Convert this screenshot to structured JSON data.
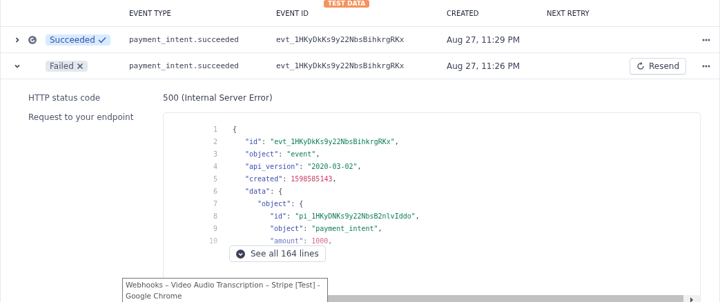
{
  "badge": "TEST DATA",
  "table": {
    "columns": [
      "EVENT TYPE",
      "EVENT ID",
      "CREATED",
      "NEXT RETRY"
    ],
    "rows": [
      {
        "expanded": false,
        "retried_icon": true,
        "status": "Succeeded",
        "kind": "succeeded",
        "event_type": "payment_intent.succeeded",
        "event_id": "evt_1HKyDkKs9y22NbsBihkrgRKx",
        "created": "Aug 27, 11:29 PM"
      },
      {
        "expanded": true,
        "retried_icon": false,
        "status": "Failed",
        "kind": "failed",
        "event_type": "payment_intent.succeeded",
        "event_id": "evt_1HKyDkKs9y22NbsBihkrgRKx",
        "created": "Aug 27, 11:26 PM",
        "action": "Resend"
      }
    ]
  },
  "details": {
    "fields": [
      {
        "label": "HTTP status code",
        "value": "500 (Internal Server Error)"
      }
    ],
    "request_label": "Request to your endpoint",
    "code": [
      {
        "number": "1",
        "tokens": [
          {
            "kind": "punct",
            "text": "{"
          }
        ]
      },
      {
        "number": "2",
        "tokens": [
          {
            "kind": "key",
            "text": "\"id\""
          },
          {
            "kind": "punct",
            "text": ": "
          },
          {
            "kind": "string",
            "text": "\"evt_1HKyDkKs9y22NbsBihkrgRKx\""
          },
          {
            "kind": "punct",
            "text": ","
          }
        ]
      },
      {
        "number": "3",
        "tokens": [
          {
            "kind": "key",
            "text": "\"object\""
          },
          {
            "kind": "punct",
            "text": ": "
          },
          {
            "kind": "string",
            "text": "\"event\""
          },
          {
            "kind": "punct",
            "text": ","
          }
        ]
      },
      {
        "number": "4",
        "tokens": [
          {
            "kind": "key",
            "text": "\"api_version\""
          },
          {
            "kind": "punct",
            "text": ": "
          },
          {
            "kind": "string",
            "text": "\"2020-03-02\""
          },
          {
            "kind": "punct",
            "text": ","
          }
        ]
      },
      {
        "number": "5",
        "tokens": [
          {
            "kind": "key",
            "text": "\"created\""
          },
          {
            "kind": "punct",
            "text": ": "
          },
          {
            "kind": "number",
            "text": "1598585143"
          },
          {
            "kind": "punct",
            "text": ","
          }
        ]
      },
      {
        "number": "6",
        "tokens": [
          {
            "kind": "key",
            "text": "\"data\""
          },
          {
            "kind": "punct",
            "text": ": {"
          }
        ]
      },
      {
        "number": "7",
        "tokens": [
          {
            "kind": "key",
            "text": "\"object\""
          },
          {
            "kind": "punct",
            "text": ": {"
          }
        ]
      },
      {
        "number": "8",
        "tokens": [
          {
            "kind": "key",
            "text": "\"id\""
          },
          {
            "kind": "punct",
            "text": ": "
          },
          {
            "kind": "string",
            "text": "\"pi_1HKyDNKs9y22NbsB2nlvIddo\""
          },
          {
            "kind": "punct",
            "text": ","
          }
        ]
      },
      {
        "number": "9",
        "tokens": [
          {
            "kind": "key",
            "text": "\"object\""
          },
          {
            "kind": "punct",
            "text": ": "
          },
          {
            "kind": "string",
            "text": "\"payment_intent\""
          },
          {
            "kind": "punct",
            "text": ","
          }
        ]
      },
      {
        "number": "10",
        "tokens": [
          {
            "kind": "key",
            "text": "\"amount\""
          },
          {
            "kind": "punct",
            "text": ": "
          },
          {
            "kind": "number",
            "text": "1000"
          },
          {
            "kind": "punct",
            "text": ","
          }
        ]
      }
    ],
    "see_all": "See all 164 lines"
  },
  "tooltip": "Webhooks – Video Audio Transcription – Stripe [Test] - Google Chrome"
}
